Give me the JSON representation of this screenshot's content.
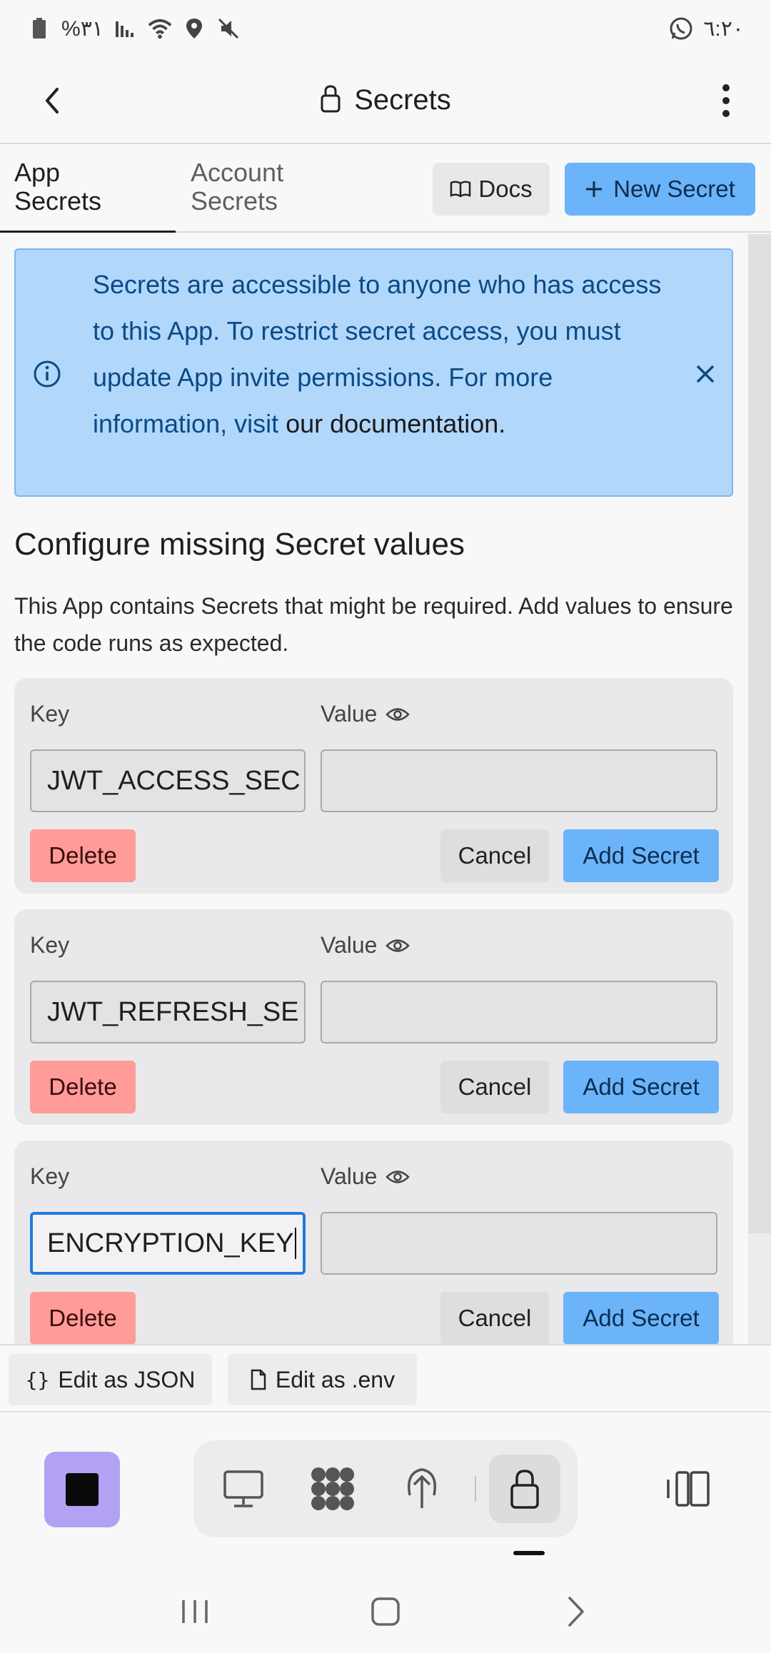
{
  "status_bar": {
    "left_text": "%٣١",
    "time": "٦:٢٠"
  },
  "header": {
    "title": "Secrets"
  },
  "tabs": {
    "app_line1": "App",
    "app_line2": "Secrets",
    "account_line1": "Account",
    "account_line2": "Secrets",
    "docs_label": "Docs",
    "new_secret_label": "New Secret"
  },
  "banner": {
    "text": "Secrets are accessible to anyone who has access to this App. To restrict secret access, you must update App invite permissions. For more information, visit",
    "link": "our documentation."
  },
  "section": {
    "title": "Configure missing Secret values",
    "description": "This App contains Secrets that might be required. Add values to ensure the code runs as expected."
  },
  "card_labels": {
    "key": "Key",
    "value": "Value",
    "delete": "Delete",
    "cancel": "Cancel",
    "add": "Add Secret"
  },
  "secrets": [
    {
      "key": "JWT_ACCESS_SEC",
      "value": ""
    },
    {
      "key": "JWT_REFRESH_SE",
      "value": ""
    },
    {
      "key": "ENCRYPTION_KEY",
      "value": ""
    }
  ],
  "edit_bar": {
    "json_label": "Edit as JSON",
    "env_label": "Edit as .env"
  },
  "colors": {
    "accent": "#6bb4f9",
    "danger": "#ff9b98",
    "banner_bg": "#b1d7fb",
    "stop_button": "#b3a1f4"
  }
}
